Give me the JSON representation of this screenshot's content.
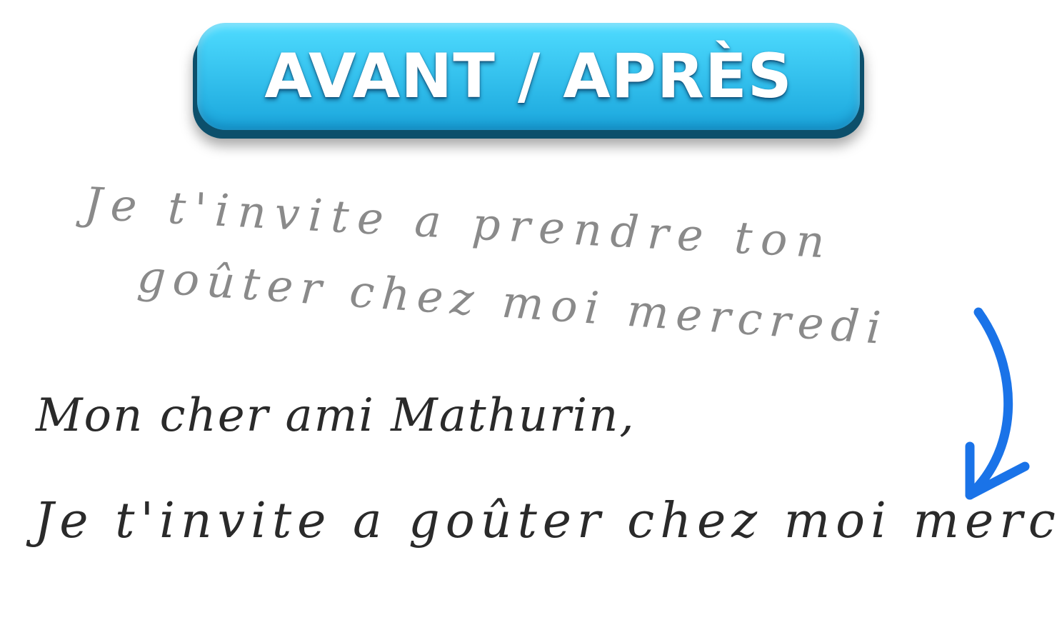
{
  "banner": {
    "title": "AVANT / APRÈS"
  },
  "before": {
    "line_1": "Je t'invite a prendre ton",
    "line_2": "goûter chez moi mercredi"
  },
  "after": {
    "line_1": "Mon cher ami Mathurin,",
    "line_2": "Je t'invite a goûter chez moi mercredi."
  },
  "arrow": {
    "icon": "curved-down-arrow-icon",
    "color": "#1a73e8"
  },
  "colors": {
    "banner_top": "#4fdcff",
    "banner_bottom": "#1aa6dc",
    "banner_edge": "#0c4f6b",
    "before_ink": "#8a8a8a",
    "after_ink": "#2a2a2a"
  }
}
